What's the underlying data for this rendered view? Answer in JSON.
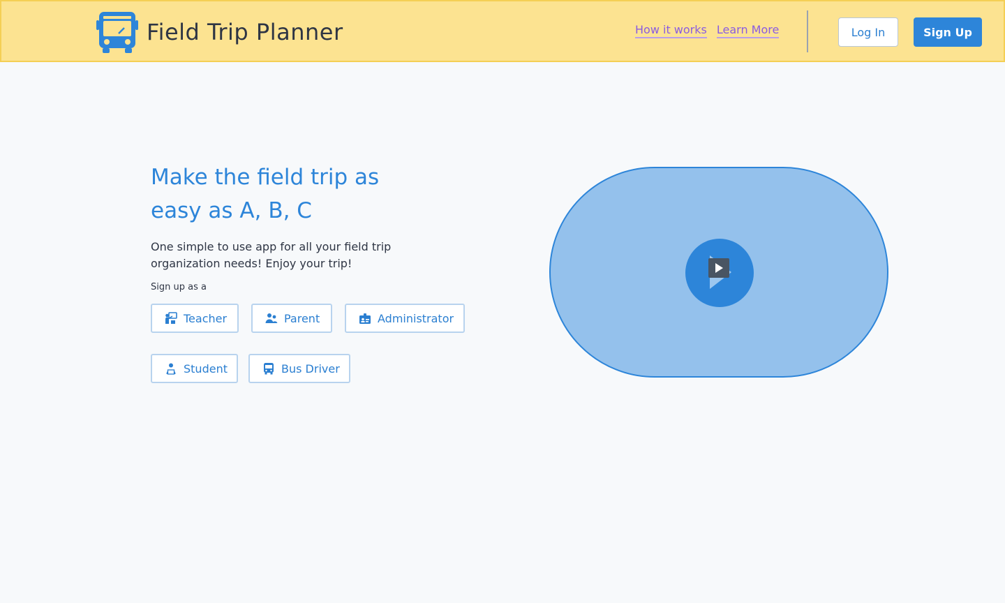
{
  "header": {
    "title": "Field Trip Planner",
    "logo_icon": "bus-icon",
    "nav": [
      {
        "label": "How it works"
      },
      {
        "label": "Learn More"
      }
    ],
    "login_label": "Log In",
    "signup_label": "Sign Up"
  },
  "hero": {
    "title": "Make the field trip as easy as A, B, C",
    "subtitle": "One simple to use app for all your field trip organization needs! Enjoy your trip!",
    "signup_as": "Sign up as a",
    "roles": [
      {
        "label": "Teacher",
        "icon": "teacher-icon"
      },
      {
        "label": "Parent",
        "icon": "parent-icon"
      },
      {
        "label": "Administrator",
        "icon": "id-card-icon"
      },
      {
        "label": "Student",
        "icon": "student-icon"
      },
      {
        "label": "Bus Driver",
        "icon": "bus-icon"
      }
    ]
  },
  "video": {
    "icon": "play-icon"
  },
  "colors": {
    "header_bg": "#fce391",
    "primary": "#2d85d9",
    "video_bg": "#94c1ec",
    "link": "#8a5ce0",
    "page_bg": "#f7f9fb"
  }
}
